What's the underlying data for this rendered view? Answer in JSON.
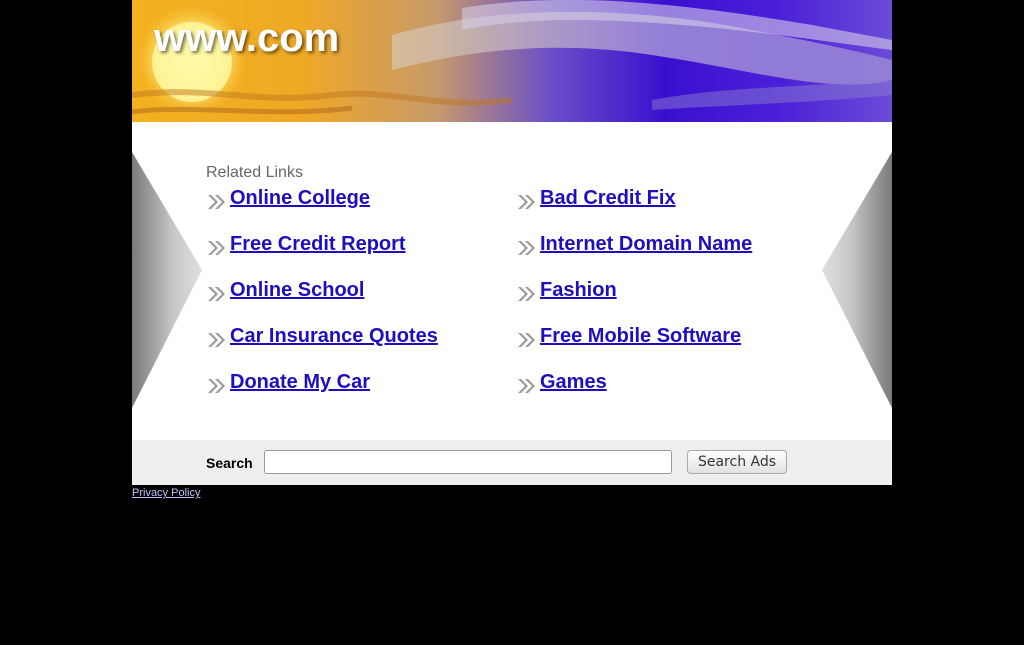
{
  "banner": {
    "title": "www.com"
  },
  "related": {
    "heading": "Related Links",
    "left": [
      {
        "label": "Online College"
      },
      {
        "label": "Free Credit Report"
      },
      {
        "label": "Online School"
      },
      {
        "label": "Car Insurance Quotes"
      },
      {
        "label": "Donate My Car"
      }
    ],
    "right": [
      {
        "label": "Bad Credit Fix"
      },
      {
        "label": "Internet Domain Name"
      },
      {
        "label": "Fashion"
      },
      {
        "label": "Free Mobile Software"
      },
      {
        "label": "Games"
      }
    ],
    "bullet_icon": "double-chevron-icon"
  },
  "search": {
    "label": "Search",
    "value": "",
    "button_label": "Search Ads"
  },
  "footer": {
    "privacy_label": "Privacy Policy"
  },
  "colors": {
    "link": "#1e0fbe",
    "page_background": "#000000",
    "search_bar_background": "#eeeeee"
  }
}
